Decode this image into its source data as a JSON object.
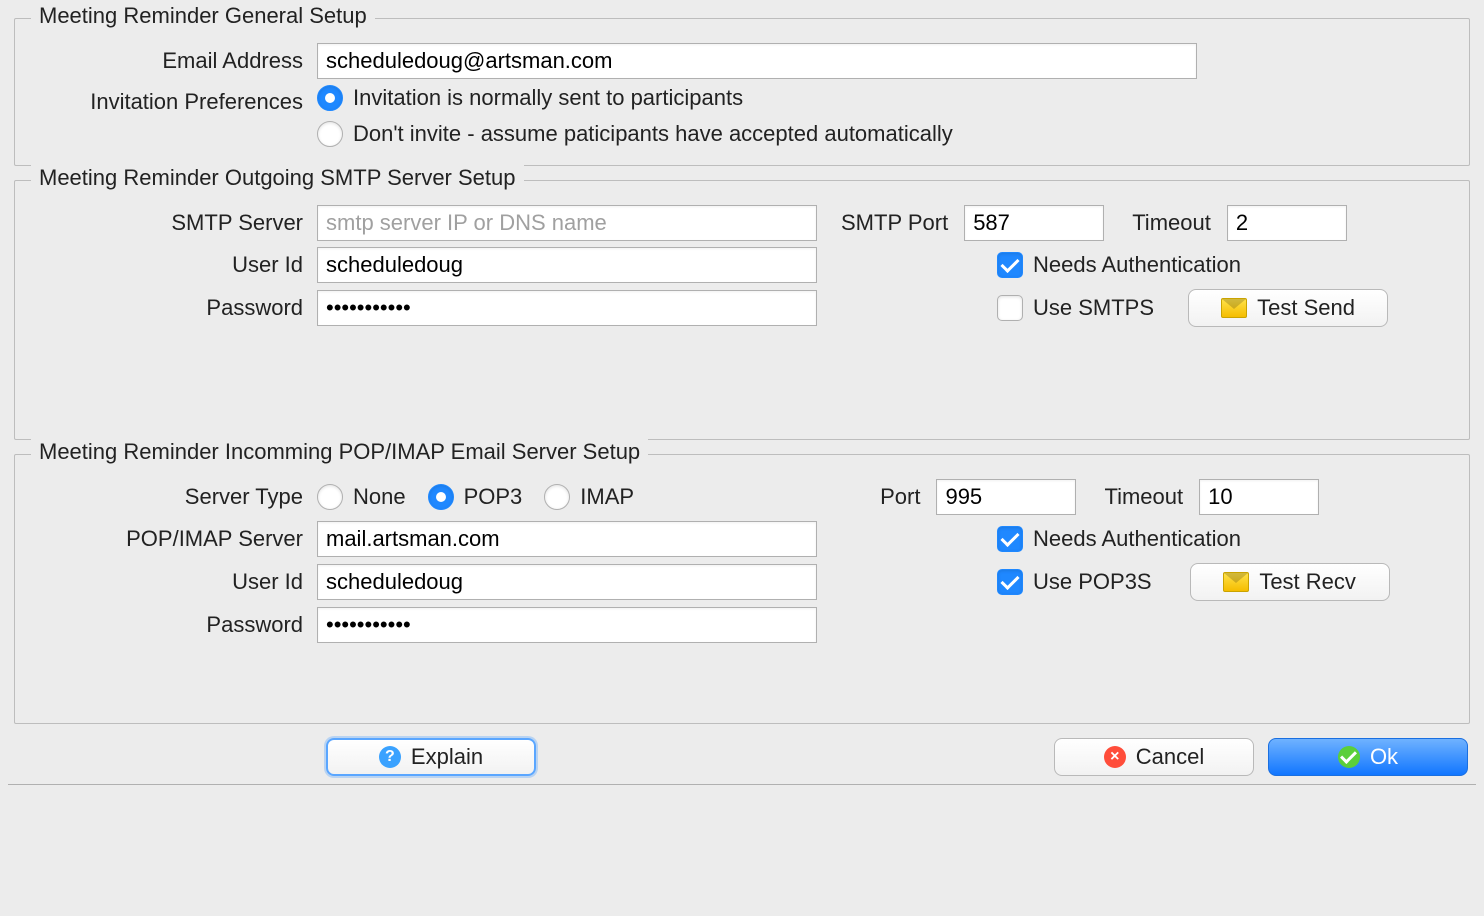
{
  "general": {
    "title": "Meeting Reminder General Setup",
    "email_label": "Email Address",
    "email_value": "scheduledoug@artsman.com",
    "invite_label": "Invitation Preferences",
    "invite_options": {
      "send": "Invitation is normally sent to participants",
      "noinvite": "Don't invite - assume paticipants have accepted automatically",
      "selected": "send"
    }
  },
  "smtp": {
    "title": "Meeting Reminder Outgoing SMTP Server Setup",
    "server_label": "SMTP Server",
    "server_placeholder": "smtp server IP or DNS name",
    "server_value": "",
    "user_label": "User Id",
    "user_value": "scheduledoug",
    "password_label": "Password",
    "password_value": "•••••••••••",
    "port_label": "SMTP Port",
    "port_value": "587",
    "timeout_label": "Timeout",
    "timeout_value": "2",
    "auth_label": "Needs Authentication",
    "auth_checked": true,
    "smtps_label": "Use SMTPS",
    "smtps_checked": false,
    "test_label": "Test Send"
  },
  "incoming": {
    "title": "Meeting Reminder Incomming POP/IMAP Email Server Setup",
    "type_label": "Server Type",
    "type_options": {
      "none": "None",
      "pop3": "POP3",
      "imap": "IMAP",
      "selected": "pop3"
    },
    "server_label": "POP/IMAP Server",
    "server_value": "mail.artsman.com",
    "user_label": "User Id",
    "user_value": "scheduledoug",
    "password_label": "Password",
    "password_value": "•••••••••••",
    "port_label": "Port",
    "port_value": "995",
    "timeout_label": "Timeout",
    "timeout_value": "10",
    "auth_label": "Needs Authentication",
    "auth_checked": true,
    "pop3s_label": "Use POP3S",
    "pop3s_checked": true,
    "test_label": "Test Recv"
  },
  "footer": {
    "explain": "Explain",
    "cancel": "Cancel",
    "ok": "Ok"
  }
}
